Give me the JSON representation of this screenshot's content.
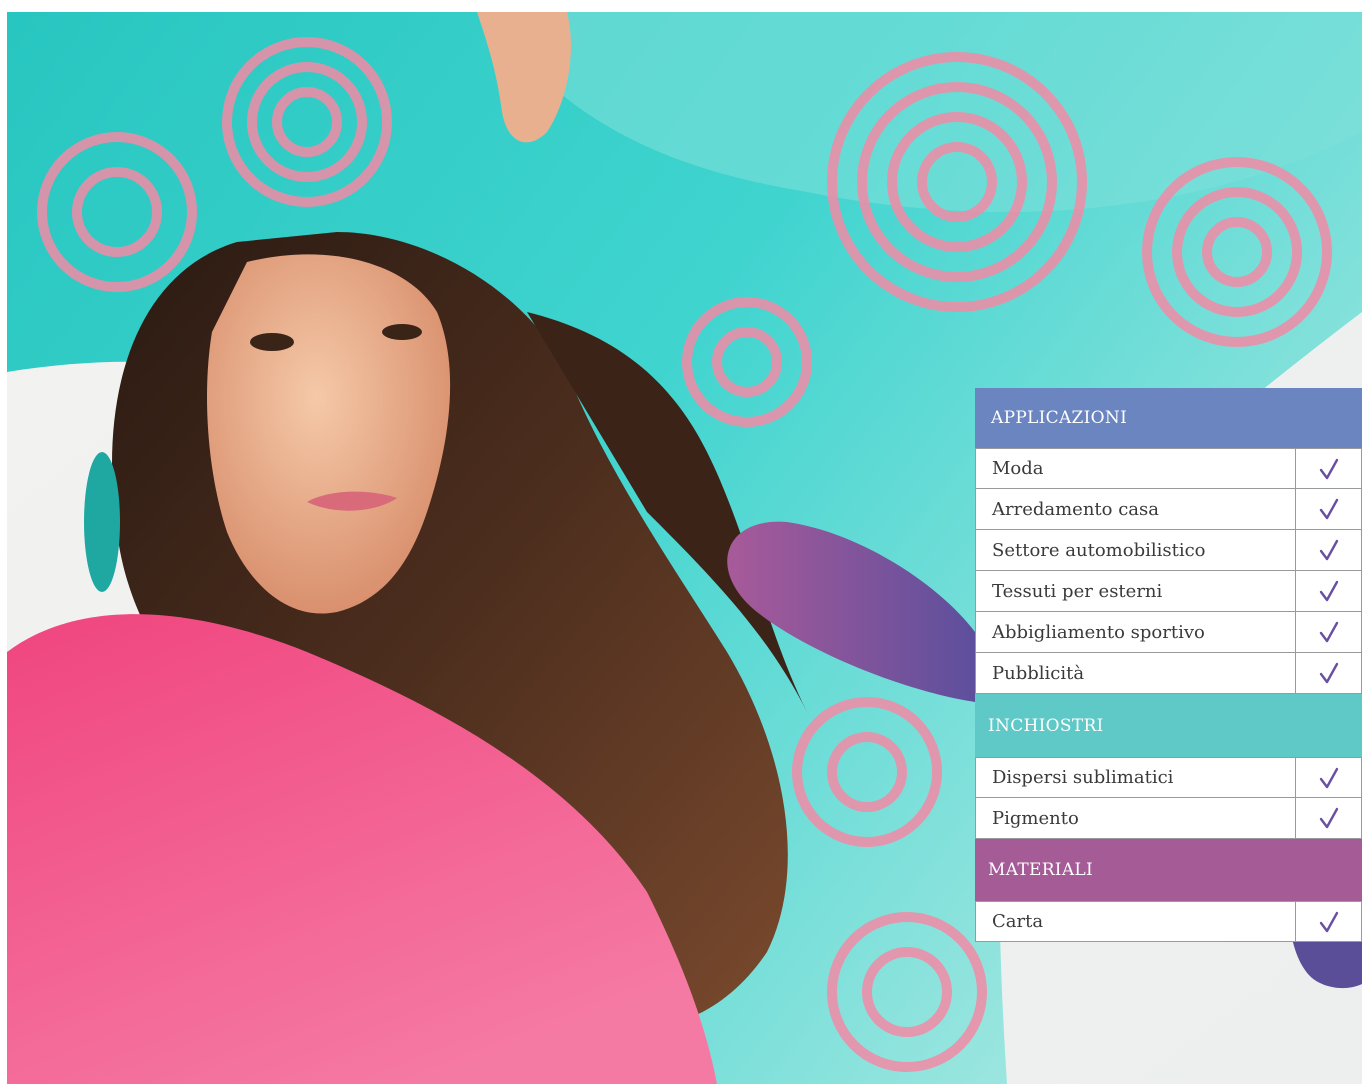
{
  "colors": {
    "applicazioni_header": "#6a85bf",
    "inchiostri_header": "#5ec9c7",
    "materiali_header": "#a45b96",
    "check": "#6a4fa0"
  },
  "sections": {
    "applicazioni": {
      "title": "APPLICAZIONI",
      "rows": [
        {
          "label": "Moda",
          "check_icon": "checkmark-icon"
        },
        {
          "label": "Arredamento casa",
          "check_icon": "checkmark-icon"
        },
        {
          "label": "Settore automobilistico",
          "check_icon": "checkmark-icon"
        },
        {
          "label": "Tessuti per esterni",
          "check_icon": "checkmark-icon"
        },
        {
          "label": "Abbigliamento sportivo",
          "check_icon": "checkmark-icon"
        },
        {
          "label": "Pubblicità",
          "check_icon": "checkmark-icon"
        }
      ]
    },
    "inchiostri": {
      "title": "INCHIOSTRI",
      "rows": [
        {
          "label": "Dispersi sublimatici",
          "check_icon": "checkmark-icon"
        },
        {
          "label": "Pigmento",
          "check_icon": "checkmark-icon"
        }
      ]
    },
    "materiali": {
      "title": "MATERIALI",
      "rows": [
        {
          "label": "Carta",
          "check_icon": "checkmark-icon"
        }
      ]
    }
  }
}
